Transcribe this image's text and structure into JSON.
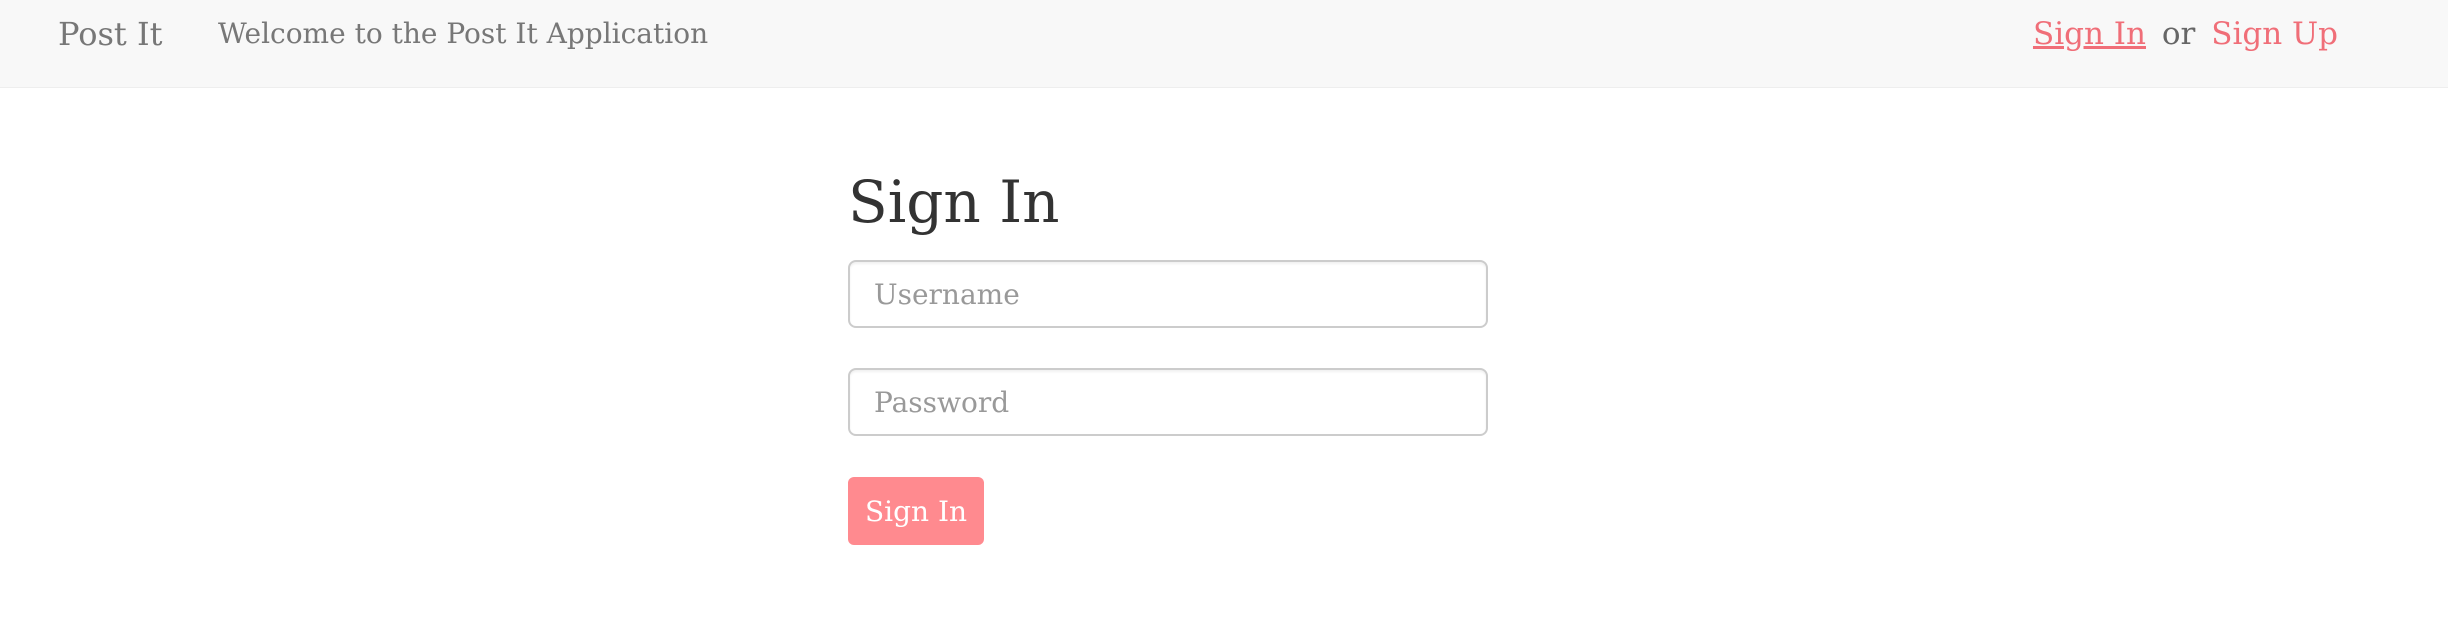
{
  "navbar": {
    "brand": "Post It",
    "tagline": "Welcome to the Post It Application",
    "sign_in_link": "Sign In",
    "separator": "or",
    "sign_up_link": "Sign Up"
  },
  "form": {
    "title": "Sign In",
    "username_placeholder": "Username",
    "username_value": "",
    "password_placeholder": "Password",
    "password_value": "",
    "submit_label": "Sign In"
  },
  "colors": {
    "navbar_bg": "#f8f8f8",
    "link": "#f06e78",
    "button": "#ff8a8f",
    "text_muted": "#777777"
  }
}
